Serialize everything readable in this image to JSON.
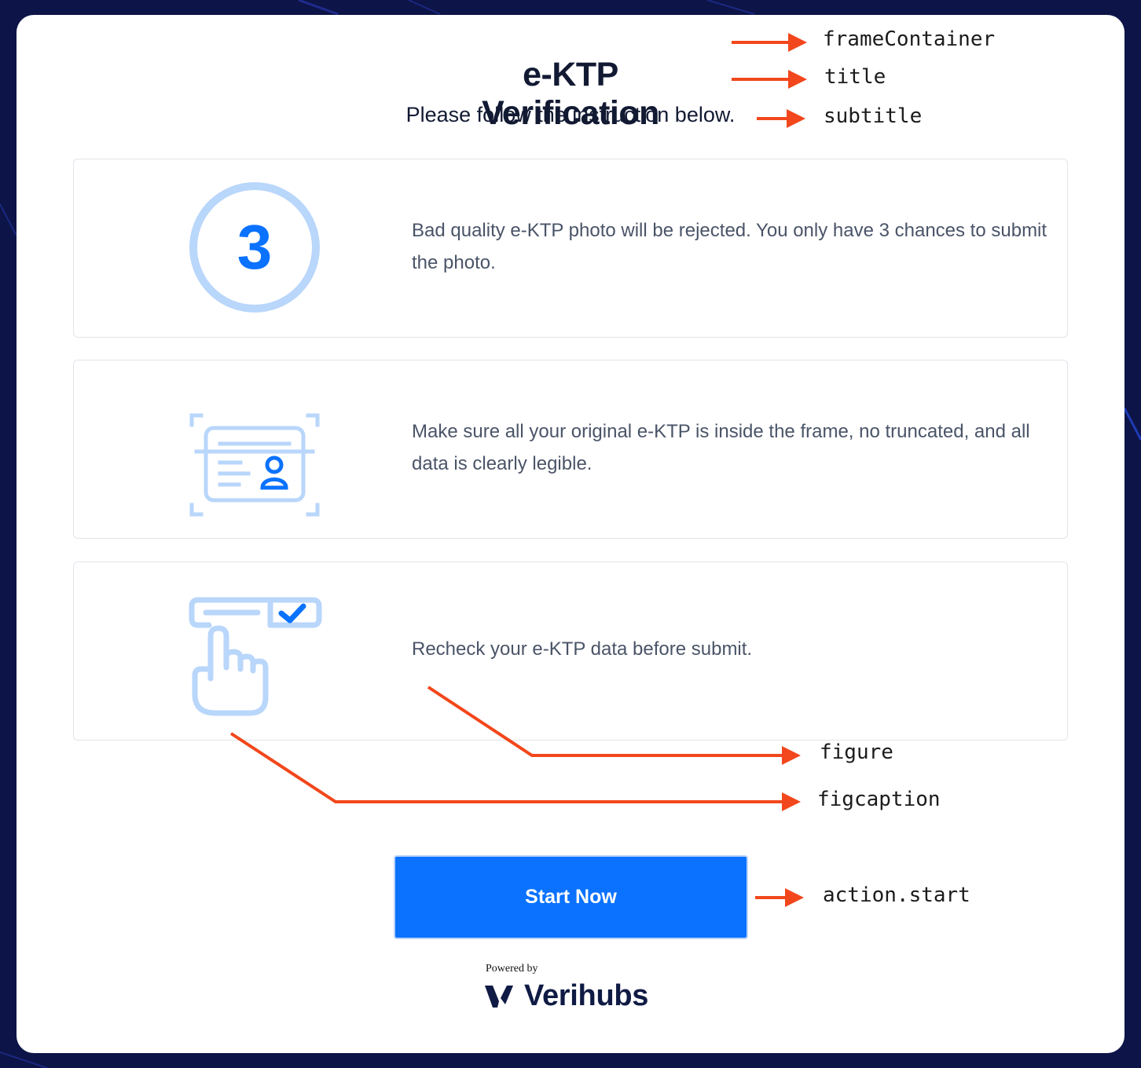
{
  "header": {
    "title": "e-KTP Verification",
    "subtitle": "Please follow the instruction below."
  },
  "instructions": [
    {
      "icon": "three-attempts-icon",
      "number": "3",
      "text": "Bad quality e-KTP photo will be rejected. You only have 3 chances to submit the photo."
    },
    {
      "icon": "id-card-frame-icon",
      "text": "Make sure all your original e-KTP is inside the frame, no truncated, and all data is clearly legible."
    },
    {
      "icon": "tap-check-icon",
      "text": "Recheck your e-KTP data before submit."
    }
  ],
  "action": {
    "start_label": "Start Now"
  },
  "footer": {
    "powered_by": "Powered by",
    "brand": "Verihubs"
  },
  "annotations": {
    "frame_container": "frameContainer",
    "title": "title",
    "subtitle": "subtitle",
    "figure": "figure",
    "figcaption": "figcaption",
    "action_start": "action.start"
  },
  "colors": {
    "background": "#0d1447",
    "accent": "#0a72ff",
    "icon_light": "#b9d6fb",
    "annotation_arrow": "#f2471c"
  }
}
